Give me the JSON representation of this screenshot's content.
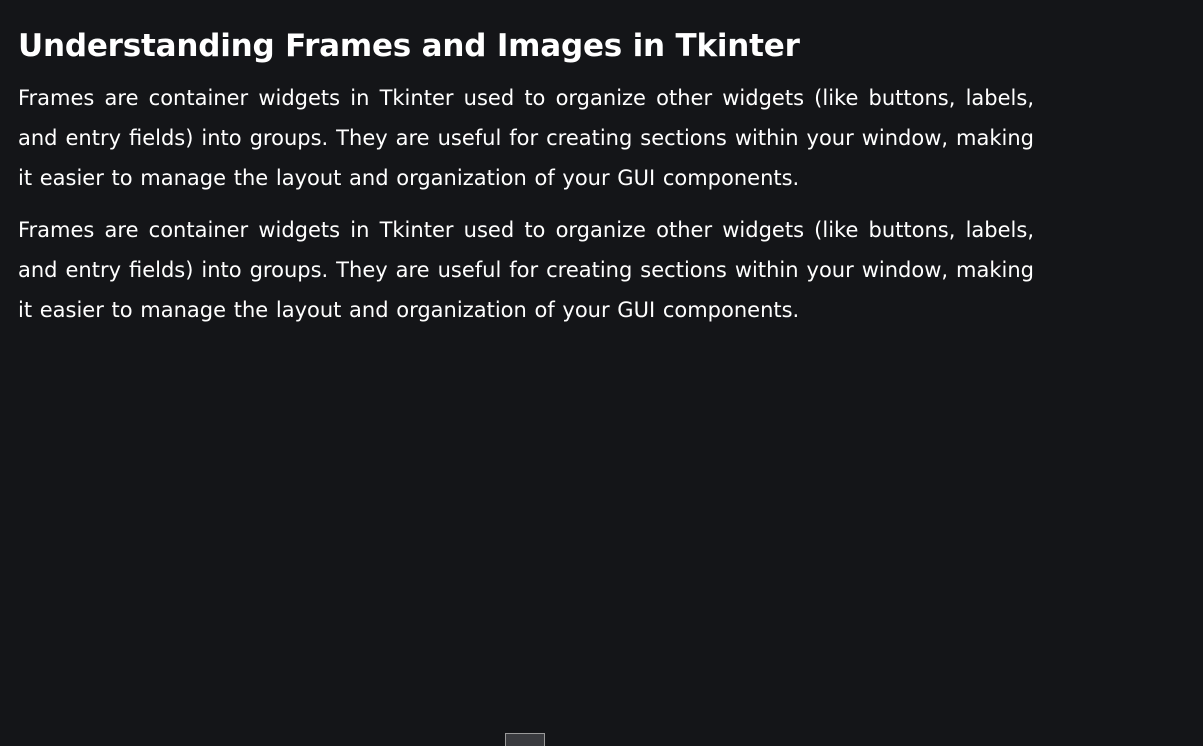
{
  "article": {
    "title": "Understanding Frames and Images in Tkinter",
    "paragraphs": [
      "Frames are container widgets in Tkinter used to organize other widgets (like buttons, labels, and entry fields) into groups. They are useful for creating sections within your window, making it easier to manage the layout and organization of your GUI components.",
      "Frames are container widgets in Tkinter used to organize other widgets (like buttons, labels, and entry fields) into groups. They are useful for creating sections within your window, making it easier to manage the layout and organization of your GUI components."
    ]
  },
  "colors": {
    "background": "#141518",
    "text": "#ffffff"
  }
}
